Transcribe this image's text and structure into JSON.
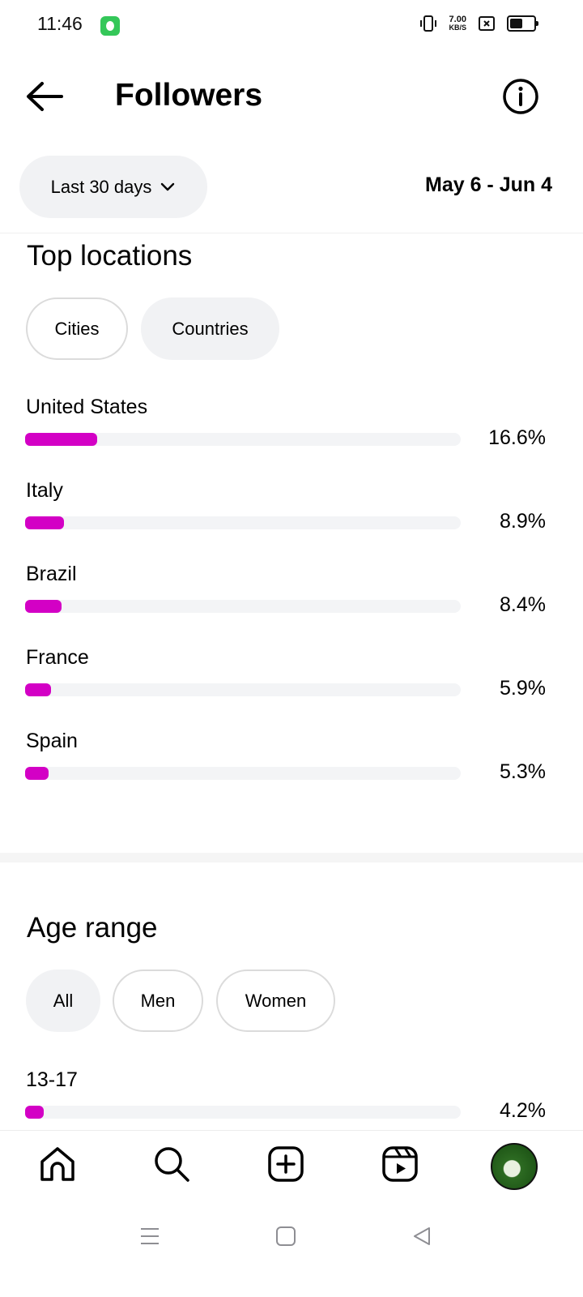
{
  "status_bar": {
    "time": "11:46",
    "net_speed_value": "7.00",
    "net_speed_unit": "KB/S",
    "battery_level": 0.55
  },
  "header": {
    "title": "Followers",
    "back_icon": "arrow-left-icon",
    "info_icon": "info-icon"
  },
  "filters": {
    "range_label": "Last 30 days",
    "date_range": "May 6 - Jun 4"
  },
  "top_locations": {
    "title": "Top locations",
    "tabs": [
      {
        "label": "Cities",
        "selected": false
      },
      {
        "label": "Countries",
        "selected": true
      }
    ],
    "items": [
      {
        "label": "United States",
        "value": "16.6%",
        "fraction": 0.166
      },
      {
        "label": "Italy",
        "value": "8.9%",
        "fraction": 0.089
      },
      {
        "label": "Brazil",
        "value": "8.4%",
        "fraction": 0.084
      },
      {
        "label": "France",
        "value": "5.9%",
        "fraction": 0.059
      },
      {
        "label": "Spain",
        "value": "5.3%",
        "fraction": 0.053
      }
    ]
  },
  "age_range": {
    "title": "Age range",
    "tabs": [
      {
        "label": "All",
        "selected": true
      },
      {
        "label": "Men",
        "selected": false
      },
      {
        "label": "Women",
        "selected": false
      }
    ],
    "items": [
      {
        "label": "13-17",
        "value": "4.2%",
        "fraction": 0.042
      }
    ]
  },
  "bottom_nav": [
    "home-icon",
    "search-icon",
    "create-icon",
    "reels-icon",
    "profile-avatar"
  ],
  "colors": {
    "accent": "#d300c5",
    "track": "#f3f4f6",
    "pill": "#f1f2f4"
  }
}
